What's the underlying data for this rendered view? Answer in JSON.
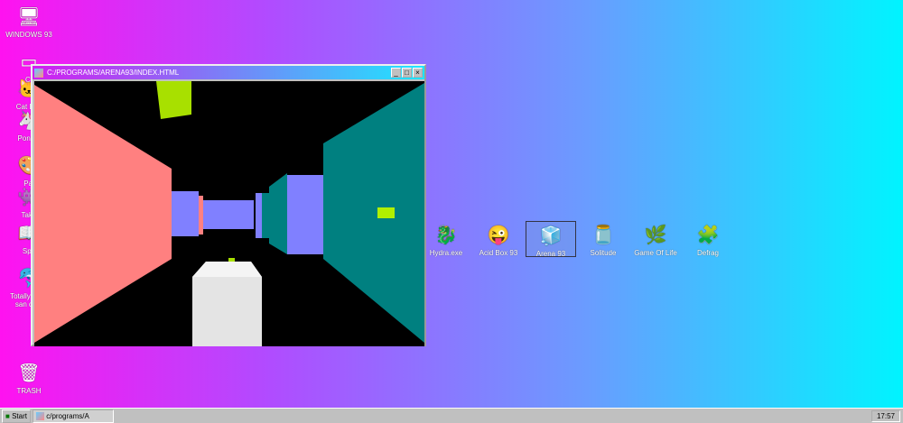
{
  "desktop_left": [
    {
      "label": "WINDOWS 93",
      "icon": "computer-icon",
      "glyph": "🖥"
    },
    {
      "label": "C:",
      "icon": "drive-icon",
      "glyph": "▭"
    },
    {
      "label": "Cat Exp",
      "icon": "cat-icon",
      "glyph": "🐱"
    },
    {
      "label": "Pony ..",
      "icon": "pony-icon",
      "glyph": "🦄"
    },
    {
      "label": "Pai",
      "icon": "paint-icon",
      "glyph": "🎨"
    },
    {
      "label": "Take",
      "icon": "take-icon",
      "glyph": "👾"
    },
    {
      "label": "Spe",
      "icon": "speech-icon",
      "glyph": "📖"
    },
    {
      "label": "Totally virus san dolp",
      "icon": "dolphin-icon",
      "glyph": "🐬"
    }
  ],
  "trash": {
    "label": "TRASH",
    "glyph": "🗑"
  },
  "desktop_row": [
    {
      "label": "Hydra.exe",
      "icon": "hydra-icon",
      "glyph": "🐉"
    },
    {
      "label": "Acid Box 93",
      "icon": "smiley-icon",
      "glyph": "😜"
    },
    {
      "label": "Arena 93",
      "icon": "cube-icon",
      "glyph": "🧊",
      "selected": true
    },
    {
      "label": "Solitude",
      "icon": "jar-icon",
      "glyph": "🫙"
    },
    {
      "label": "Game Of Life",
      "icon": "life-icon",
      "glyph": "🌿"
    },
    {
      "label": "Defrag",
      "icon": "defrag-icon",
      "glyph": "🧩"
    }
  ],
  "window": {
    "title": "C:/PROGRAMS/ARENA93/INDEX.HTML",
    "min": "_",
    "max": "□",
    "close": "×"
  },
  "taskbar": {
    "start": "Start",
    "task": "c/programs/A",
    "clock": "17:57"
  }
}
